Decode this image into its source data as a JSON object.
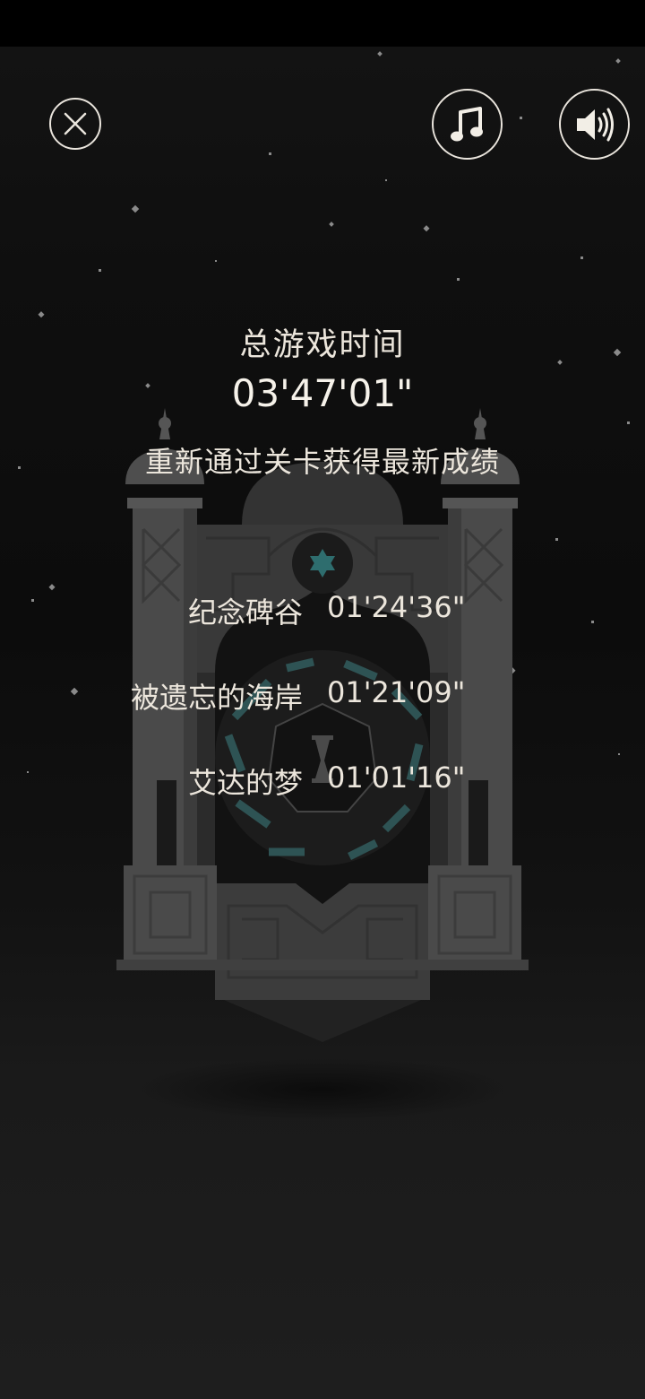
{
  "stats": {
    "title": "总游戏时间",
    "total_time": "03'47'01\"",
    "subtitle": "重新通过关卡获得最新成绩"
  },
  "levels": [
    {
      "name": "纪念碑谷",
      "time": "01'24'36\""
    },
    {
      "name": "被遗忘的海岸",
      "time": "01'21'09\""
    },
    {
      "name": "艾达的梦",
      "time": "01'01'16\""
    }
  ],
  "controls": {
    "close_icon": "close-icon",
    "music_icon": "music-note-icon",
    "sound_icon": "speaker-volume-icon"
  },
  "colors": {
    "background": "#0f0f0f",
    "text": "#ece6dc",
    "monument": "#3e3e3e",
    "accent_teal": "#2e6d6e"
  }
}
